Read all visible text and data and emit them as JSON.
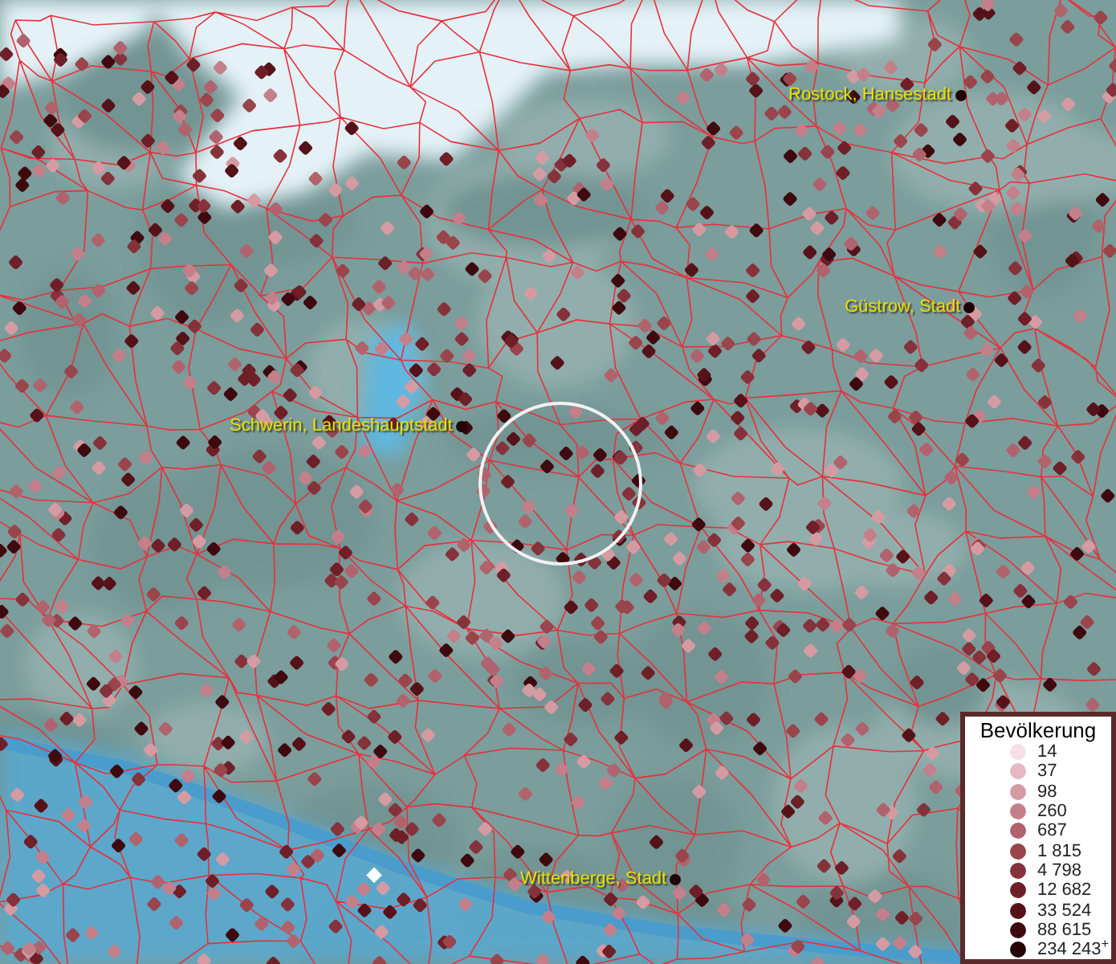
{
  "map": {
    "places": [
      {
        "name": "Rostock, Hansestadt"
      },
      {
        "name": "Güstrow, Stadt"
      },
      {
        "name": "Schwerin, Landeshauptstadt"
      },
      {
        "name": "Wittenberge, Stadt"
      }
    ]
  },
  "legend": {
    "title": "Bevölkerung",
    "items": [
      {
        "label": "14",
        "color": "#f6dfe8"
      },
      {
        "label": "37",
        "color": "#e6b8c3"
      },
      {
        "label": "98",
        "color": "#d59ba3"
      },
      {
        "label": "260",
        "color": "#c3808a"
      },
      {
        "label": "687",
        "color": "#b0636d"
      },
      {
        "label": "1 815",
        "color": "#9a444c"
      },
      {
        "label": "4 798",
        "color": "#85323b"
      },
      {
        "label": "12 682",
        "color": "#6e1f28"
      },
      {
        "label": "33 524",
        "color": "#561219"
      },
      {
        "label": "88 615",
        "color": "#3e0a0f"
      },
      {
        "label": "234 243$^{+}$",
        "color": "#260407"
      }
    ]
  }
}
